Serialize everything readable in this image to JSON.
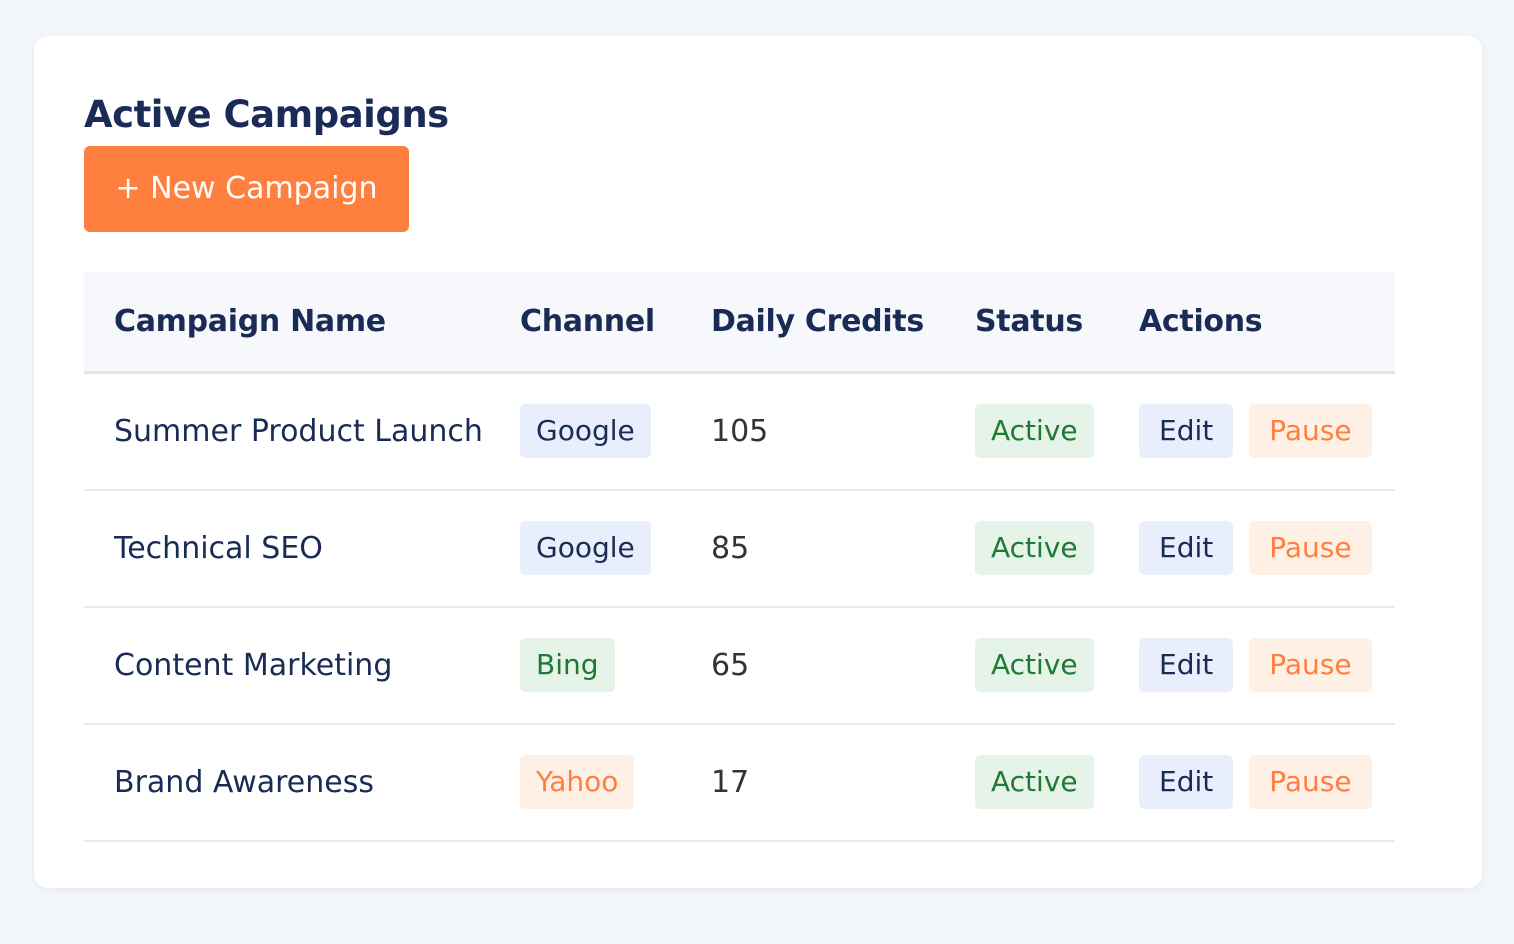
{
  "page": {
    "title": "Active Campaigns",
    "new_button_label": "+ New Campaign"
  },
  "colors": {
    "accent": "#ff7f3e",
    "heading": "#1a2b55",
    "active_green": "#1f7a33"
  },
  "table": {
    "headers": [
      "Campaign Name",
      "Channel",
      "Daily Credits",
      "Status",
      "Actions"
    ],
    "rows": [
      {
        "name": "Summer Product Launch",
        "channel": "Google",
        "channel_style": "google",
        "credits": "105",
        "status": "Active",
        "edit_label": "Edit",
        "pause_label": "Pause"
      },
      {
        "name": "Technical SEO",
        "channel": "Google",
        "channel_style": "google",
        "credits": "85",
        "status": "Active",
        "edit_label": "Edit",
        "pause_label": "Pause"
      },
      {
        "name": "Content Marketing",
        "channel": "Bing",
        "channel_style": "bing",
        "credits": "65",
        "status": "Active",
        "edit_label": "Edit",
        "pause_label": "Pause"
      },
      {
        "name": "Brand Awareness",
        "channel": "Yahoo",
        "channel_style": "yahoo",
        "credits": "17",
        "status": "Active",
        "edit_label": "Edit",
        "pause_label": "Pause"
      }
    ]
  }
}
